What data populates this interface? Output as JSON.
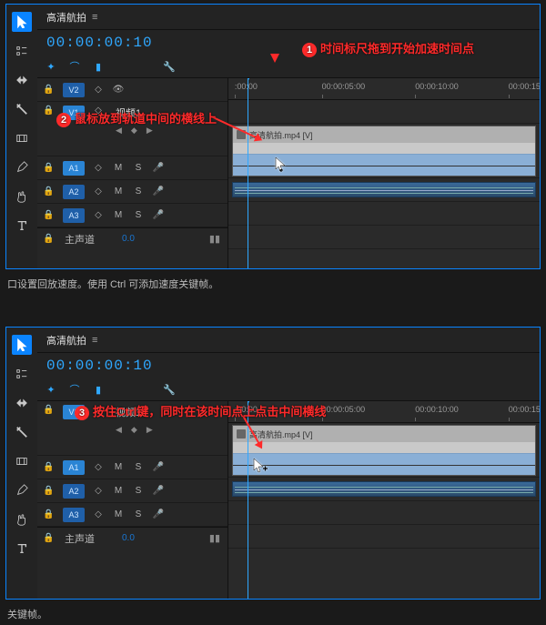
{
  "tab_title": "高清航拍",
  "timecode": "00:00:00:10",
  "ruler_ticks": [
    {
      "label": ":00:00",
      "pct": 2
    },
    {
      "label": "00:00:05:00",
      "pct": 30
    },
    {
      "label": "00:00:10:00",
      "pct": 60
    },
    {
      "label": "00:00:15:0",
      "pct": 90
    }
  ],
  "playhead_pct": 6,
  "video_tracks": [
    {
      "tag": "V2",
      "expanded": false
    },
    {
      "tag": "V1",
      "expanded": true,
      "name": "视频1"
    }
  ],
  "audio_tracks": [
    {
      "tag": "A1"
    },
    {
      "tag": "A2"
    },
    {
      "tag": "A3"
    }
  ],
  "track_letters": {
    "m": "M",
    "s": "S"
  },
  "master": {
    "label": "主声道",
    "value": "0.0"
  },
  "clip": {
    "label": "高清航拍.mp4 [V]"
  },
  "annotations": {
    "step1": "时间标尺拖到开始加速时间点",
    "step2": "鼠标放到轨道中间的横线上",
    "step3": "按住Ctrl键，同时在该时间点上点击中间横线"
  },
  "captions": {
    "top": "口设置回放速度。使用 Ctrl 可添加速度关键帧。",
    "bottom": "关键帧。"
  }
}
